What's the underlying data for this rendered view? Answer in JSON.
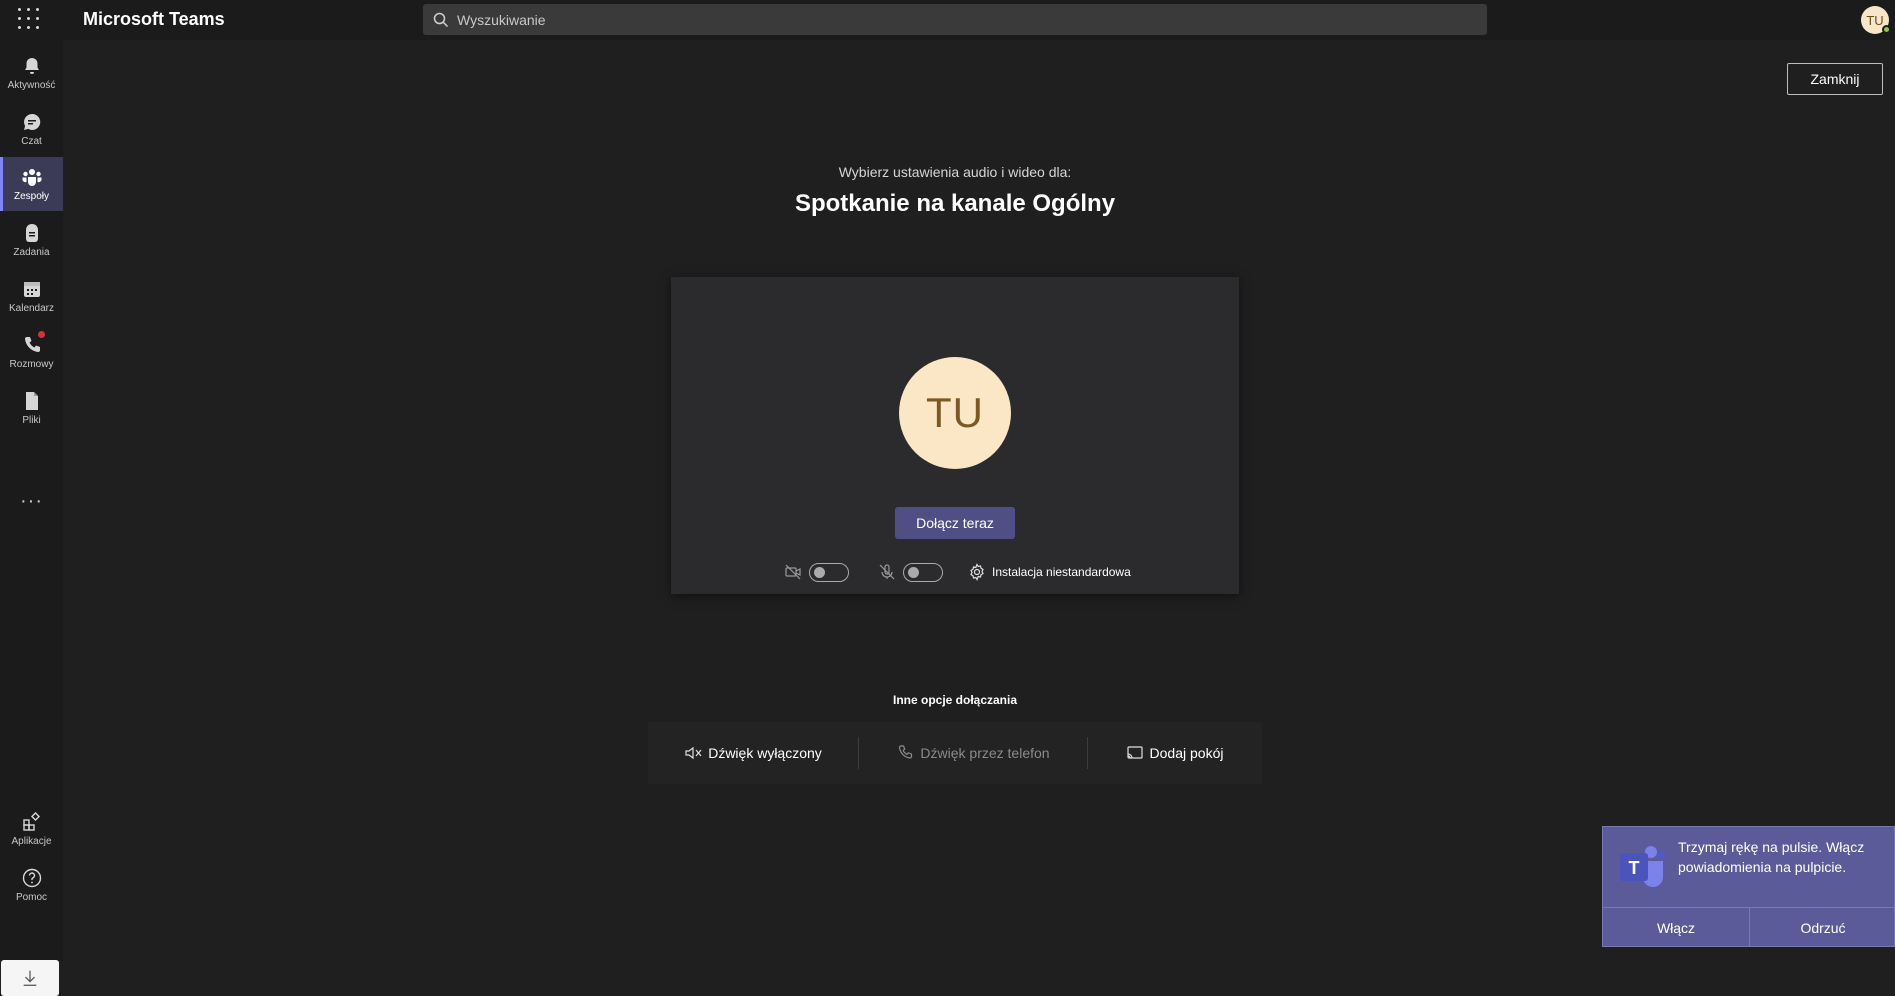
{
  "app": {
    "title": "Microsoft Teams",
    "user_initials": "TU"
  },
  "search": {
    "placeholder": "Wyszukiwanie"
  },
  "rail": {
    "items": [
      {
        "label": "Aktywność",
        "icon": "bell-icon"
      },
      {
        "label": "Czat",
        "icon": "chat-icon"
      },
      {
        "label": "Zespoły",
        "icon": "teams-icon",
        "active": true
      },
      {
        "label": "Zadania",
        "icon": "tasks-icon"
      },
      {
        "label": "Kalendarz",
        "icon": "calendar-icon"
      },
      {
        "label": "Rozmowy",
        "icon": "phone-icon",
        "badge": true
      },
      {
        "label": "Pliki",
        "icon": "file-icon"
      }
    ],
    "more": "···",
    "bottom": [
      {
        "label": "Aplikacje",
        "icon": "apps-icon"
      },
      {
        "label": "Pomoc",
        "icon": "help-icon"
      }
    ]
  },
  "prejoin": {
    "close_label": "Zamknij",
    "subtitle": "Wybierz ustawienia audio i wideo dla:",
    "meeting_title": "Spotkanie na kanale Ogólny",
    "avatar_initials": "TU",
    "join_label": "Dołącz teraz",
    "custom_setup_label": "Instalacja niestandardowa",
    "camera_on": false,
    "mic_on": false
  },
  "other_options": {
    "title": "Inne opcje dołączania",
    "items": [
      {
        "label": "Dźwięk wyłączony",
        "icon": "speaker-off-icon",
        "enabled": true
      },
      {
        "label": "Dźwięk przez telefon",
        "icon": "phone-icon",
        "enabled": false
      },
      {
        "label": "Dodaj pokój",
        "icon": "cast-icon",
        "enabled": true
      }
    ]
  },
  "toast": {
    "message": "Trzymaj rękę na pulsie. Włącz powiadomienia na pulpicie.",
    "accept_label": "Włącz",
    "dismiss_label": "Odrzuć"
  },
  "colors": {
    "background": "#1f1f1f",
    "rail": "#1b1b1b",
    "accent": "#4f4f85",
    "toast": "#5b5b99",
    "avatar": "#fbe6c6"
  }
}
